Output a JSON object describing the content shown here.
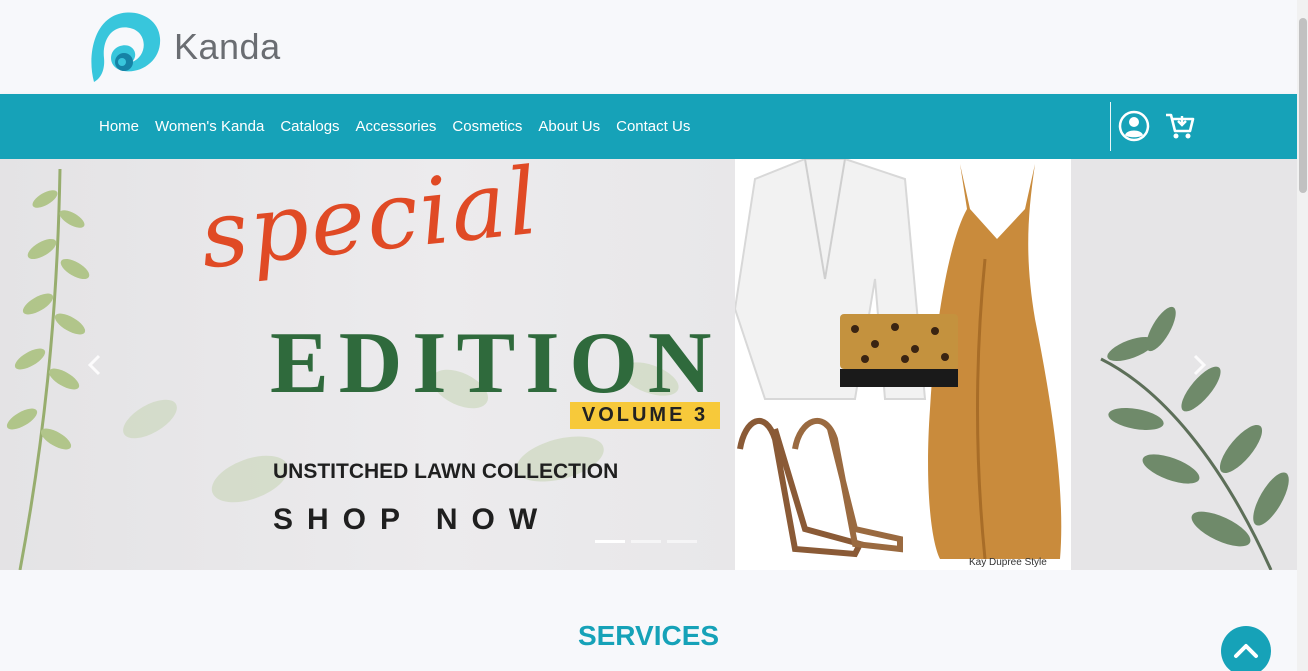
{
  "brand": {
    "name": "Kanda",
    "accent": "#16a2b8"
  },
  "nav": {
    "items": [
      {
        "label": "Home"
      },
      {
        "label": "Women's Kanda"
      },
      {
        "label": "Catalogs"
      },
      {
        "label": "Accessories"
      },
      {
        "label": "Cosmetics"
      },
      {
        "label": "About Us"
      },
      {
        "label": "Contact Us"
      }
    ],
    "icons": [
      "user-account-icon",
      "shopping-cart-icon"
    ]
  },
  "hero": {
    "script_title": "special",
    "headline": "EDITION",
    "badge": "VOLUME 3",
    "subtitle": "UNSTITCHED LAWN COLLECTION",
    "cta": "SHOP NOW",
    "photo_caption": "Kay Dupree Style",
    "slides": 3,
    "active_slide": 1,
    "colors": {
      "script": "#e04a25",
      "headline": "#2f6a3c",
      "badge": "#f7c93a"
    }
  },
  "services": {
    "title": "SERVICES"
  }
}
